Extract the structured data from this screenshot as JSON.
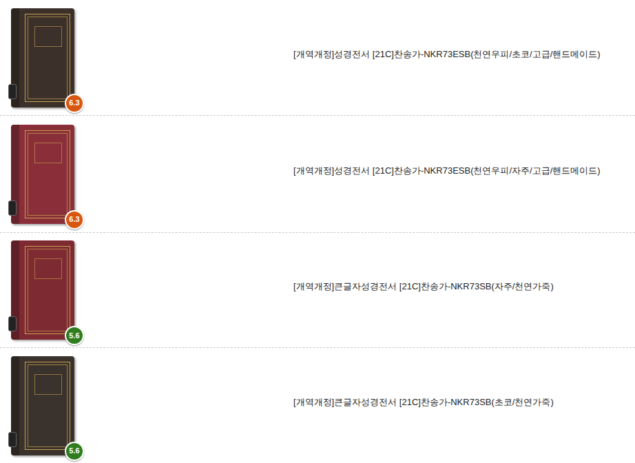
{
  "products": [
    {
      "title": "[개역개정]성경전서 [21C]찬송가-NKR73ESB(천연우피/초코/고급/핸드메이드)",
      "color": "#3b302a",
      "badge": {
        "text": "6.3",
        "color": "#d9560f"
      }
    },
    {
      "title": "[개역개정]성경전서 [21C]찬송가-NKR73ESB(천연우피/자주/고급/핸드메이드)",
      "color": "#8a2f3a",
      "badge": {
        "text": "6.3",
        "color": "#d9560f"
      }
    },
    {
      "title": "[개역개정]큰글자성경전서 [21C]찬송가-NKR73SB(자주/천연가죽)",
      "color": "#7e2a33",
      "badge": {
        "text": "5.6",
        "color": "#2f7d1f"
      }
    },
    {
      "title": "[개역개정]큰글자성경전서 [21C]찬송가-NKR73SB(초코/천연가죽)",
      "color": "#3a322c",
      "badge": {
        "text": "5.6",
        "color": "#2f7d1f"
      }
    }
  ]
}
